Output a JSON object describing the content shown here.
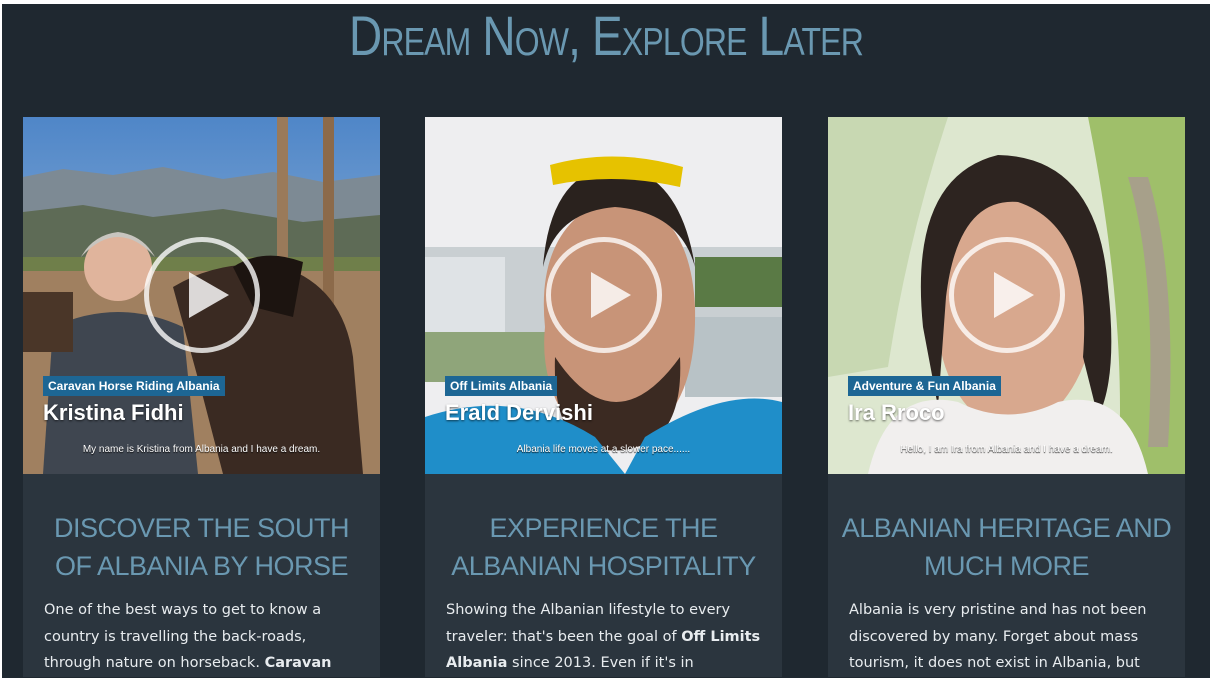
{
  "page": {
    "title": "Dream Now, Explore Later"
  },
  "colors": {
    "background": "#1f2830",
    "card": "#2b353e",
    "accent": "#6a98b1",
    "tag": "#1d6694",
    "text": "#e8ecef"
  },
  "cards": [
    {
      "video": {
        "channel_tag": "Caravan Horse Riding Albania",
        "person_name": "Kristina Fidhi",
        "subtitle": "My name is Kristina from Albania and I have a dream.",
        "icon": "play-icon"
      },
      "heading": "Discover the South of Albania by Horse",
      "body": {
        "text_1": "One of the best ways to get to know a country is travelling the back-roads, through nature on horseback. ",
        "bold_1": "Caravan"
      }
    },
    {
      "video": {
        "channel_tag": "Off Limits Albania",
        "person_name": "Erald Dervishi",
        "subtitle": "Albania life moves at a slower pace......",
        "icon": "play-icon"
      },
      "heading": "Experience the Albanian Hospitality",
      "body": {
        "text_1": "Showing the Albanian lifestyle to every traveler: that's been the goal of ",
        "bold_1": "Off Limits Albania",
        "text_2": " since 2013. Even if it's in"
      }
    },
    {
      "video": {
        "channel_tag": "Adventure & Fun Albania",
        "person_name": "Ira Rroco",
        "subtitle": "Hello, I am Ira from Albania and I have a dream.",
        "icon": "play-icon"
      },
      "heading": "Albanian Heritage and Much More",
      "body": {
        "text_1": "Albania is very pristine and has not been discovered by many. Forget about mass tourism, it does not exist in Albania, but"
      }
    }
  ]
}
